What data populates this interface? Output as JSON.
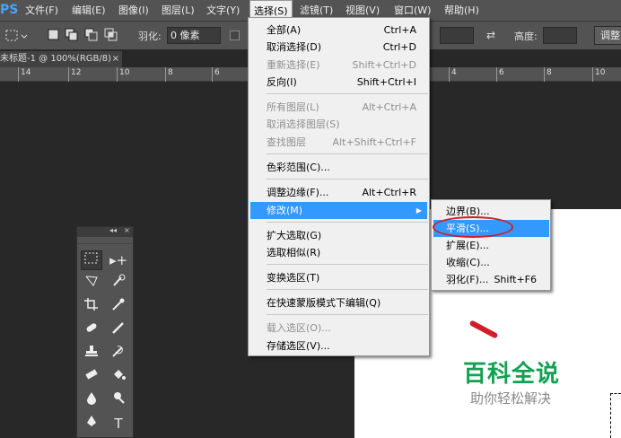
{
  "app": {
    "logo": "PS"
  },
  "menubar": {
    "items": [
      {
        "label": "文件(F)"
      },
      {
        "label": "编辑(E)"
      },
      {
        "label": "图像(I)"
      },
      {
        "label": "图层(L)"
      },
      {
        "label": "文字(Y)"
      },
      {
        "label": "选择(S)"
      },
      {
        "label": "滤镜(T)"
      },
      {
        "label": "视图(V)"
      },
      {
        "label": "窗口(W)"
      },
      {
        "label": "帮助(H)"
      }
    ]
  },
  "options": {
    "feather_label": "羽化:",
    "feather_value": "0 像素",
    "height_label": "高度:",
    "refine_button": "调整"
  },
  "document": {
    "tab_title": "未标题-1 @ 100%(RGB/8)",
    "close": "×"
  },
  "ruler": {
    "ticks": [
      "14",
      "12",
      "10",
      "8",
      "6",
      "4",
      "6",
      "8",
      "10"
    ]
  },
  "toolbox": {
    "collapse": "◂◂",
    "close": "×"
  },
  "select_menu": {
    "items": [
      {
        "label": "全部(A)",
        "shortcut": "Ctrl+A"
      },
      {
        "label": "取消选择(D)",
        "shortcut": "Ctrl+D"
      },
      {
        "label": "重新选择(E)",
        "shortcut": "Shift+Ctrl+D"
      },
      {
        "label": "反向(I)",
        "shortcut": "Shift+Ctrl+I"
      },
      {
        "label": "所有图层(L)",
        "shortcut": "Alt+Ctrl+A"
      },
      {
        "label": "取消选择图层(S)",
        "shortcut": ""
      },
      {
        "label": "查找图层",
        "shortcut": "Alt+Shift+Ctrl+F"
      },
      {
        "label": "色彩范围(C)...",
        "shortcut": ""
      },
      {
        "label": "调整边缘(F)...",
        "shortcut": "Alt+Ctrl+R"
      },
      {
        "label": "修改(M)",
        "shortcut": ""
      },
      {
        "label": "扩大选取(G)",
        "shortcut": ""
      },
      {
        "label": "选取相似(R)",
        "shortcut": ""
      },
      {
        "label": "变换选区(T)",
        "shortcut": ""
      },
      {
        "label": "在快速蒙版模式下编辑(Q)",
        "shortcut": ""
      },
      {
        "label": "载入选区(O)...",
        "shortcut": ""
      },
      {
        "label": "存储选区(V)...",
        "shortcut": ""
      }
    ]
  },
  "modify_submenu": {
    "items": [
      {
        "label": "边界(B)...",
        "shortcut": ""
      },
      {
        "label": "平滑(S)...",
        "shortcut": ""
      },
      {
        "label": "扩展(E)...",
        "shortcut": ""
      },
      {
        "label": "收缩(C)...",
        "shortcut": ""
      },
      {
        "label": "羽化(F)...",
        "shortcut": "Shift+F6"
      }
    ]
  },
  "watermark": {
    "title": "百科全说",
    "subtitle": "助你轻松解决"
  },
  "colors": {
    "highlight": "#3399ff",
    "annotation": "#d21e2a",
    "watermark": "#12a152"
  }
}
